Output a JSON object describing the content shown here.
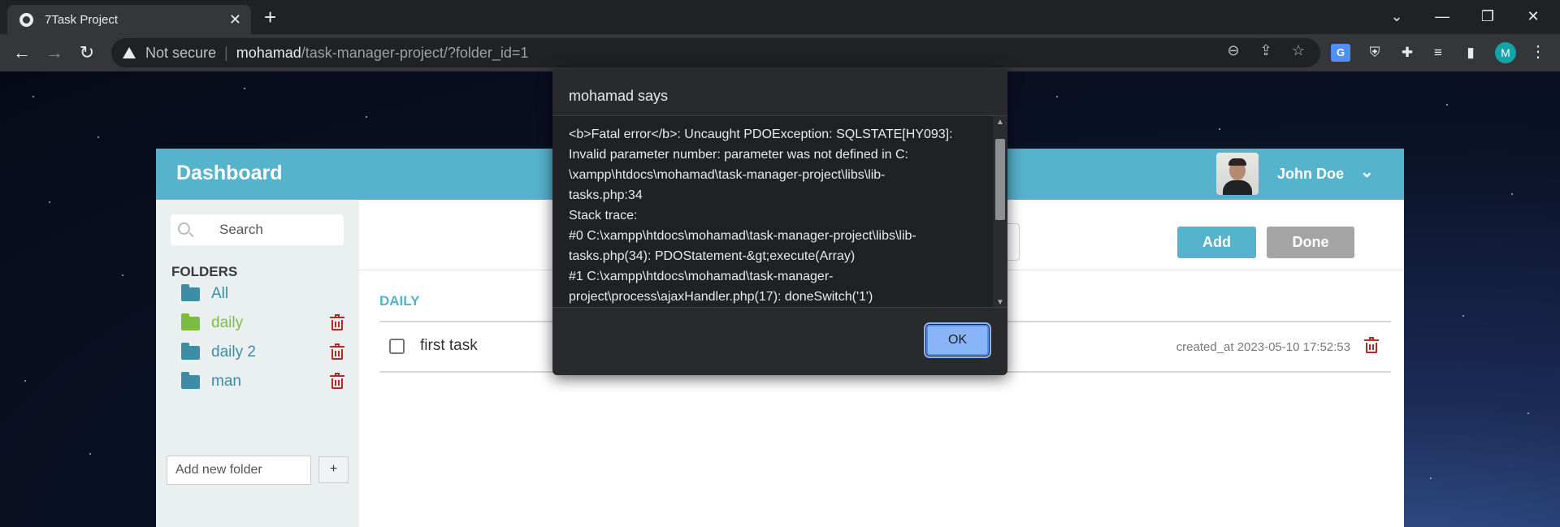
{
  "browser": {
    "tab_title": "7Task Project",
    "tab_close": "✕",
    "new_tab": "+",
    "not_secure": "Not secure",
    "url_host": "mohamad",
    "url_path": "/task-manager-project/?folder_id=1",
    "profile_initial": "M"
  },
  "app": {
    "title": "Dashboard",
    "user_name": "John Doe",
    "search_placeholder": "Search",
    "folders_title": "FOLDERS",
    "folders": [
      {
        "label": "All",
        "active": false,
        "deletable": false
      },
      {
        "label": "daily",
        "active": true,
        "deletable": true
      },
      {
        "label": "daily 2",
        "active": false,
        "deletable": true
      },
      {
        "label": "man",
        "active": false,
        "deletable": true
      }
    ],
    "add_folder_placeholder": "Add new folder",
    "add_folder_button": "+",
    "add_button": "Add",
    "done_button": "Done",
    "folder_heading": "DAILY",
    "tasks": [
      {
        "title": "first task",
        "created": "created_at 2023-05-10 17:52:53"
      }
    ]
  },
  "dialog": {
    "title": "mohamad says",
    "message": "<b>Fatal error</b>:  Uncaught PDOException: SQLSTATE[HY093]:\nInvalid parameter number: parameter was not defined in C:\n\\xampp\\htdocs\\mohamad\\task-manager-project\\libs\\lib-\ntasks.php:34\nStack trace:\n#0 C:\\xampp\\htdocs\\mohamad\\task-manager-project\\libs\\lib-\ntasks.php(34): PDOStatement-&gt;execute(Array)\n#1 C:\\xampp\\htdocs\\mohamad\\task-manager-\nproject\\process\\ajaxHandler.php(17): doneSwitch('1')",
    "ok_button": "OK"
  },
  "colors": {
    "header": "#55b3cc",
    "active_folder": "#7cbd41",
    "folder": "#3d8da6",
    "trash": "#b32b25"
  }
}
